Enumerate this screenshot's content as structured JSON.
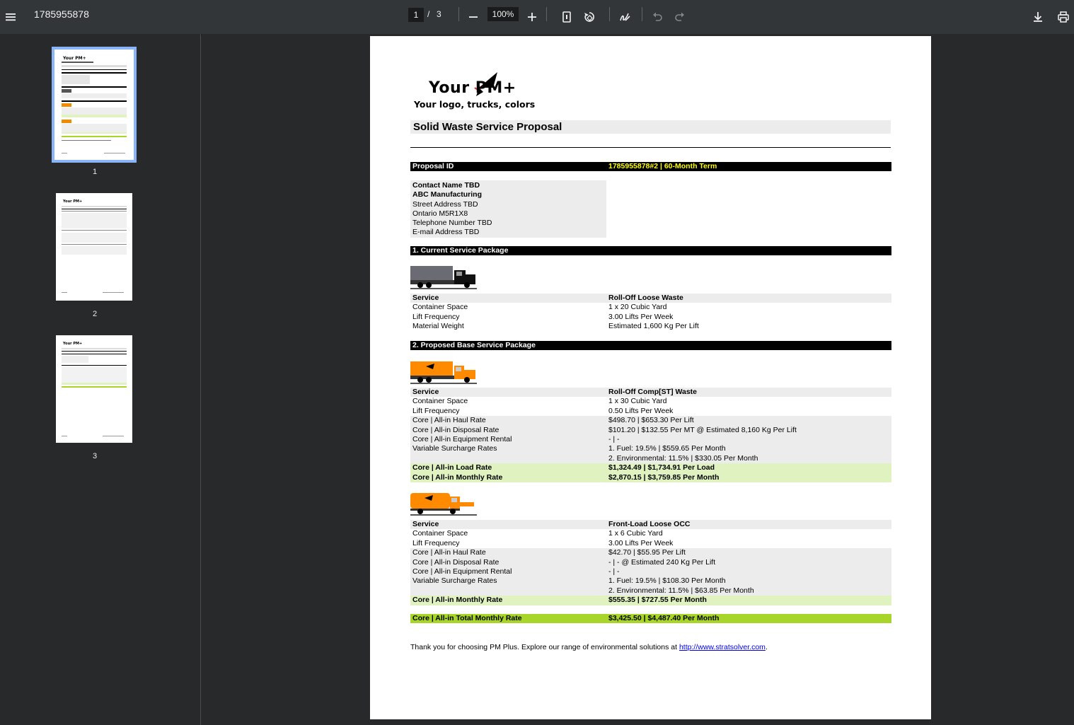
{
  "toolbar": {
    "title": "1785955878",
    "page_current": "1",
    "page_sep": "/",
    "page_total": "3",
    "zoom": "100%"
  },
  "thumbnails": [
    {
      "label": "1",
      "selected": true
    },
    {
      "label": "2",
      "selected": false
    },
    {
      "label": "3",
      "selected": false
    }
  ],
  "doc": {
    "logo_main": "Your PM+",
    "logo_sub": "Your logo, trucks, colors",
    "title": "Solid Waste Service Proposal",
    "proposal_label": "Proposal ID",
    "proposal_value": "1785955878#2 | 60-Month Term",
    "contact": [
      "Contact Name TBD",
      "ABC Manufacturing",
      "Street Address TBD",
      "Ontario M5R1X8",
      "Telephone Number TBD",
      "E-mail Address TBD"
    ],
    "section1": "1. Current Service Package",
    "current": [
      {
        "l": "Service",
        "r": "Roll-Off Loose Waste"
      },
      {
        "l": "Container Space",
        "r": "1 x 20 Cubic Yard"
      },
      {
        "l": "Lift Frequency",
        "r": "3.00 Lifts Per Week"
      },
      {
        "l": "Material Weight",
        "r": "Estimated 1,600 Kg Per Lift"
      }
    ],
    "section2": "2. Proposed Base Service Package",
    "proposed1": [
      {
        "l": "Service",
        "r": "Roll-Off Comp[ST] Waste"
      },
      {
        "l": "Container Space",
        "r": "1 x 30 Cubic Yard"
      },
      {
        "l": "Lift Frequency",
        "r": "0.50 Lifts Per Week"
      },
      {
        "l": "Core | All-in Haul Rate",
        "r": "$498.70 | $653.30 Per Lift"
      },
      {
        "l": "Core | All-in Disposal Rate",
        "r": "$101.20 | $132.55 Per MT @ Estimated 8,160 Kg Per Lift"
      },
      {
        "l": "Core | All-in Equipment Rental",
        "r": "- | -"
      },
      {
        "l": "Variable Surcharge Rates",
        "r": "1. Fuel: 19.5% | $559.65 Per Month"
      },
      {
        "l": "",
        "r": "2. Environmental: 11.5% | $330.05 Per Month"
      },
      {
        "l": "Core | All-in Load Rate",
        "r": "$1,324.49 | $1,734.91 Per Load"
      },
      {
        "l": "Core | All-in Monthly Rate",
        "r": "$2,870.15 | $3,759.85 Per Month"
      }
    ],
    "proposed2": [
      {
        "l": "Service",
        "r": "Front-Load Loose OCC"
      },
      {
        "l": "Container Space",
        "r": "1 x 6 Cubic Yard"
      },
      {
        "l": "Lift Frequency",
        "r": "3.00 Lifts Per Week"
      },
      {
        "l": "Core | All-in Haul Rate",
        "r": "$42.70 | $55.95 Per Lift"
      },
      {
        "l": "Core | All-in Disposal Rate",
        "r": "- | - @ Estimated 240 Kg Per Lift"
      },
      {
        "l": "Core | All-in Equipment Rental",
        "r": "- | -"
      },
      {
        "l": "Variable Surcharge Rates",
        "r": "1. Fuel: 19.5% | $108.30 Per Month"
      },
      {
        "l": "",
        "r": "2. Environmental: 11.5% | $63.85 Per Month"
      },
      {
        "l": "Core | All-in Monthly Rate",
        "r": "$555.35 | $727.55 Per Month"
      }
    ],
    "total": {
      "l": "Core | All-in Total Monthly Rate",
      "r": "$3,425.50 | $4,487.40 Per Month"
    },
    "footer_text": "Thank you for choosing PM Plus. Explore our range of environmental solutions at ",
    "footer_link": "http://www.stratsolver.com",
    "footer_end": "."
  },
  "colors": {
    "toolbar": "#323639",
    "background": "#28292a",
    "accent": "#8ab4f8",
    "highlight_light": "#dff2bf",
    "highlight_dark": "#a7d52a",
    "proposal_text": "#ffff00",
    "truck_orange": "#ff8a00"
  }
}
